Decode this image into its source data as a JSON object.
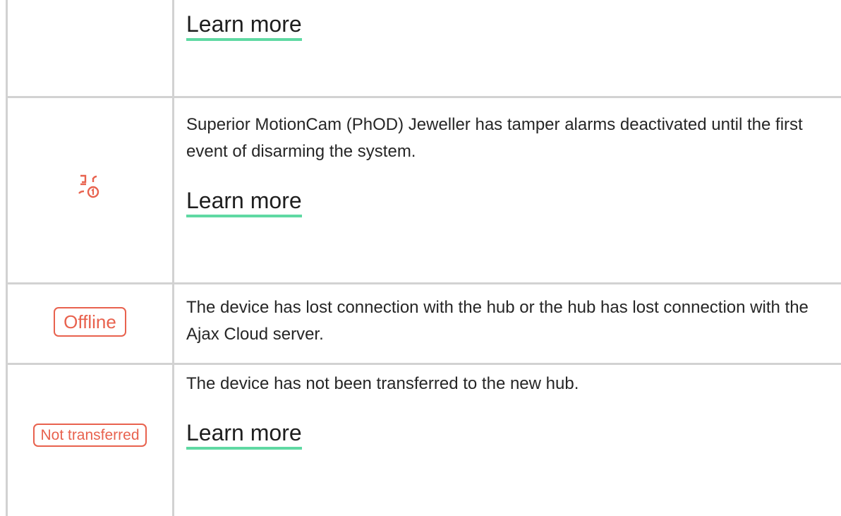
{
  "rows": [
    {
      "description": "",
      "link": "Learn more"
    },
    {
      "icon": "tamper-deactivated-icon",
      "description": "Superior MotionCam (PhOD) Jeweller has tamper alarms deactivated until the first event of disarming the system.",
      "link": "Learn more"
    },
    {
      "badge": "Offline",
      "description": "The device has lost connection with the hub or the hub has lost connection with the Ajax Cloud server."
    },
    {
      "badge": "Not transferred",
      "description": "The device has not been transferred to the new hub.",
      "link": "Learn more"
    }
  ],
  "colors": {
    "accent_red": "#e8624e",
    "link_underline": "#5fd9a3",
    "grid": "#d2d2d2"
  }
}
